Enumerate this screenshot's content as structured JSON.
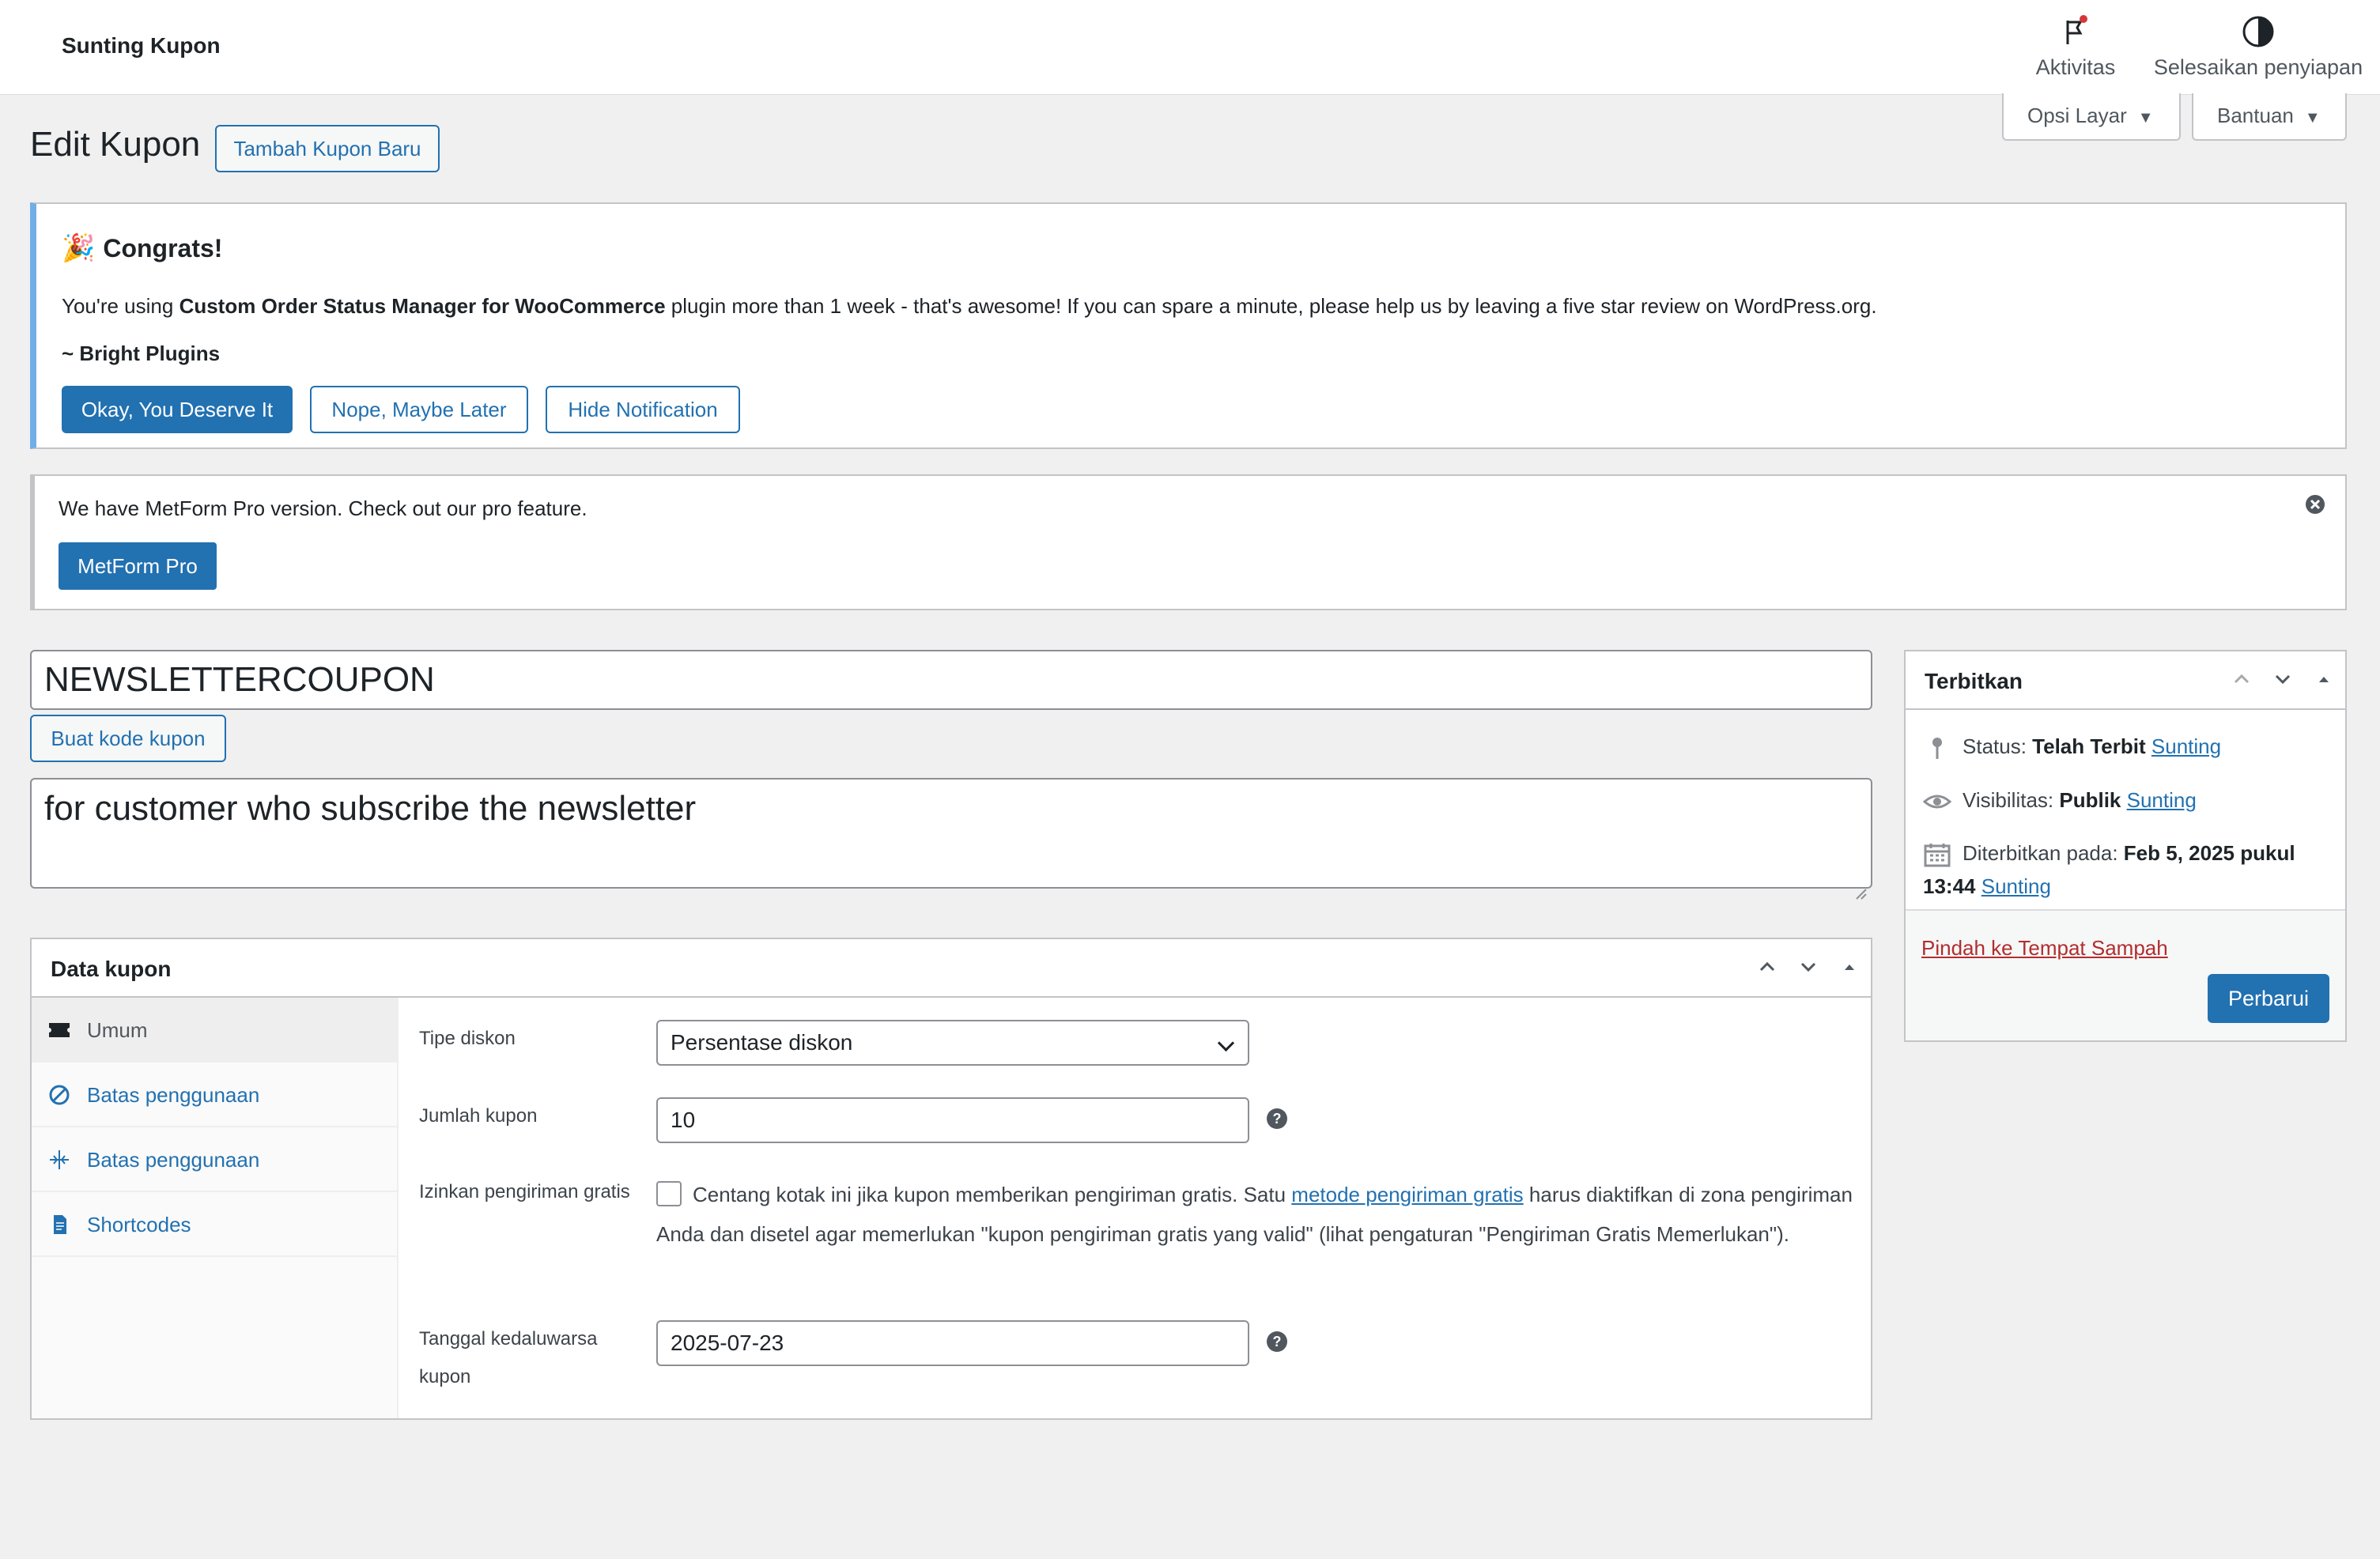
{
  "topbar": {
    "title": "Sunting Kupon",
    "activity_label": "Aktivitas",
    "setup_label": "Selesaikan penyiapan"
  },
  "screen_tabs": {
    "options": "Opsi Layar",
    "help": "Bantuan"
  },
  "page": {
    "title": "Edit Kupon",
    "add_new": "Tambah Kupon Baru"
  },
  "congrats_notice": {
    "title": "Congrats!",
    "msg_pre": "You're using ",
    "msg_bold": "Custom Order Status Manager for WooCommerce",
    "msg_post": " plugin more than 1 week - that's awesome! If you can spare a minute, please help us by leaving a five star review on WordPress.org.",
    "signature": "~ Bright Plugins",
    "btn_ok": "Okay, You Deserve It",
    "btn_nope": "Nope, Maybe Later",
    "btn_hide": "Hide Notification"
  },
  "metform_notice": {
    "message": "We have MetForm Pro version. Check out our pro feature.",
    "button": "MetForm Pro"
  },
  "coupon": {
    "code": "NEWSLETTERCOUPON",
    "generate_button": "Buat kode kupon",
    "description": "for customer who subscribe the newsletter"
  },
  "coupon_data": {
    "title": "Data kupon",
    "tabs": [
      {
        "label": "Umum",
        "icon": "ticket-icon"
      },
      {
        "label": "Batas penggunaan",
        "icon": "restriction-icon"
      },
      {
        "label": "Batas penggunaan",
        "icon": "limit-icon"
      },
      {
        "label": "Shortcodes",
        "icon": "document-icon"
      }
    ],
    "discount_type_label": "Tipe diskon",
    "discount_type_value": "Persentase diskon",
    "amount_label": "Jumlah kupon",
    "amount_value": "10",
    "free_shipping_label": "Izinkan pengiriman gratis",
    "free_shipping_text_pre": "Centang kotak ini jika kupon memberikan pengiriman gratis. Satu ",
    "free_shipping_link": "metode pengiriman gratis",
    "free_shipping_text_post": " harus diaktifkan di zona pengiriman Anda dan disetel agar memerlukan \"kupon pengiriman gratis yang valid\" (lihat pengaturan \"Pengiriman Gratis Memerlukan\").",
    "free_shipping_checked": false,
    "expiry_label_line1": "Tanggal kedaluwarsa",
    "expiry_label_line2": "kupon",
    "expiry_value": "2025-07-23"
  },
  "publish": {
    "title": "Terbitkan",
    "status_label": "Status: ",
    "status_value": "Telah Terbit",
    "visibility_label": "Visibilitas: ",
    "visibility_value": "Publik",
    "published_label": "Diterbitkan pada: ",
    "published_value": "Feb 5, 2025 pukul 13:44",
    "edit_link": "Sunting",
    "trash_link": "Pindah ke Tempat Sampah",
    "update_button": "Perbarui"
  },
  "colors": {
    "accent": "#2271b1",
    "danger": "#b32d2e",
    "notice_info": "#72aee6"
  }
}
